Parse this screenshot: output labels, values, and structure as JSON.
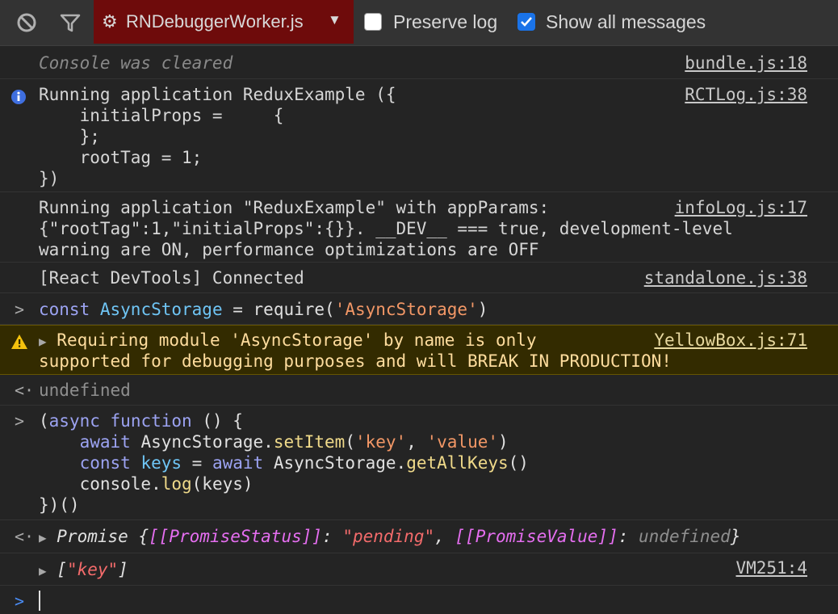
{
  "toolbar": {
    "clear_icon": "clear-console-icon",
    "filter_icon": "filter-icon",
    "context": {
      "gear_icon": "gear-icon",
      "label": "RNDebuggerWorker.js",
      "caret": "▼"
    },
    "preserve_log": {
      "label": "Preserve log",
      "checked": false
    },
    "show_all": {
      "label": "Show all messages",
      "checked": true
    },
    "accent_color": "#1a73e8",
    "context_bg": "#6e0b0b"
  },
  "messages": {
    "cleared": {
      "text": "Console was cleared",
      "source": "bundle.js:18"
    },
    "running1": {
      "lines": [
        "Running application ReduxExample ({",
        "    initialProps =     {",
        "    };",
        "    rootTag = 1;",
        "})"
      ],
      "source": "RCTLog.js:38",
      "icon": "info-icon"
    },
    "running2": {
      "lines": [
        "Running application \"ReduxExample\" with appParams:",
        "{\"rootTag\":1,\"initialProps\":{}}. __DEV__ === true, development-level",
        "warning are ON, performance optimizations are OFF"
      ],
      "source": "infoLog.js:17"
    },
    "devtools": {
      "text": "[React DevTools] Connected",
      "source": "standalone.js:38"
    },
    "cmd1": {
      "prompt": ">",
      "t1": "const",
      "t2": "AsyncStorage",
      "t3": " = ",
      "t4": "require",
      "t5": "(",
      "t6": "'AsyncStorage'",
      "t7": ")"
    },
    "warning": {
      "icon": "warning-icon",
      "expander": "▶",
      "line1": "Requiring module 'AsyncStorage' by name is only",
      "line2": "supported for debugging purposes and will BREAK IN PRODUCTION!",
      "source": "YellowBox.js:71"
    },
    "result1": {
      "prompt": "<·",
      "text": "undefined"
    },
    "cmd2": {
      "prompt": ">",
      "l1": {
        "a": "(",
        "b": "async",
        "c": " ",
        "d": "function",
        "e": " () {"
      },
      "l2": {
        "a": "    ",
        "b": "await",
        "c": " AsyncStorage.",
        "d": "setItem",
        "e": "(",
        "f": "'key'",
        "g": ", ",
        "h": "'value'",
        "i": ")"
      },
      "l3": {
        "a": "    ",
        "b": "const",
        "c": " ",
        "d": "keys",
        "e": " = ",
        "f": "await",
        "g": " AsyncStorage.",
        "h": "getAllKeys",
        "i": "()"
      },
      "l4": {
        "a": "    console.",
        "b": "log",
        "c": "(keys)"
      },
      "l5": "})()"
    },
    "result2": {
      "prompt": "<·",
      "expander": "▶",
      "a": "Promise {",
      "b": "[[PromiseStatus]]",
      "c": ": ",
      "d": "\"pending\"",
      "e": ", ",
      "f": "[[PromiseValue]]",
      "g": ": ",
      "h": "undefined",
      "i": "}"
    },
    "log": {
      "expander": "▶",
      "a": "[",
      "b": "\"key\"",
      "c": "]",
      "source": "VM251:4"
    },
    "input": {
      "prompt": ">"
    }
  }
}
